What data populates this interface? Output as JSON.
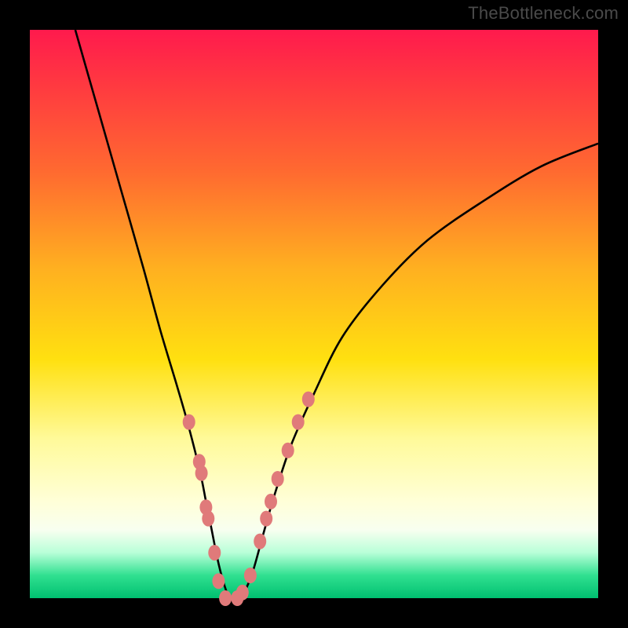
{
  "watermark": {
    "text": "TheBottleneck.com"
  },
  "colors": {
    "curve_stroke": "#000000",
    "dot_fill": "#e07a7a",
    "dot_stroke": "#c85a5a"
  },
  "chart_data": {
    "type": "line",
    "title": "",
    "xlabel": "",
    "ylabel": "",
    "xlim": [
      0,
      100
    ],
    "ylim": [
      0,
      100
    ],
    "left_curve": [
      {
        "x": 8,
        "y": 100
      },
      {
        "x": 12,
        "y": 86
      },
      {
        "x": 16,
        "y": 72
      },
      {
        "x": 20,
        "y": 58
      },
      {
        "x": 23,
        "y": 47
      },
      {
        "x": 26,
        "y": 37
      },
      {
        "x": 28,
        "y": 30
      },
      {
        "x": 30,
        "y": 22
      },
      {
        "x": 31,
        "y": 17
      },
      {
        "x": 32,
        "y": 12
      },
      {
        "x": 33,
        "y": 7
      },
      {
        "x": 34,
        "y": 3
      },
      {
        "x": 35,
        "y": 0
      }
    ],
    "right_curve": [
      {
        "x": 35,
        "y": 0
      },
      {
        "x": 37,
        "y": 0
      },
      {
        "x": 39,
        "y": 4
      },
      {
        "x": 41,
        "y": 11
      },
      {
        "x": 43,
        "y": 18
      },
      {
        "x": 46,
        "y": 27
      },
      {
        "x": 50,
        "y": 36
      },
      {
        "x": 55,
        "y": 46
      },
      {
        "x": 62,
        "y": 55
      },
      {
        "x": 70,
        "y": 63
      },
      {
        "x": 80,
        "y": 70
      },
      {
        "x": 90,
        "y": 76
      },
      {
        "x": 100,
        "y": 80
      }
    ],
    "dots": [
      {
        "x": 28.0,
        "y": 31
      },
      {
        "x": 29.8,
        "y": 24
      },
      {
        "x": 30.2,
        "y": 22
      },
      {
        "x": 31.0,
        "y": 16
      },
      {
        "x": 31.4,
        "y": 14
      },
      {
        "x": 32.5,
        "y": 8
      },
      {
        "x": 33.2,
        "y": 3
      },
      {
        "x": 34.4,
        "y": 0
      },
      {
        "x": 36.5,
        "y": 0
      },
      {
        "x": 37.4,
        "y": 1
      },
      {
        "x": 38.8,
        "y": 4
      },
      {
        "x": 40.5,
        "y": 10
      },
      {
        "x": 41.6,
        "y": 14
      },
      {
        "x": 42.4,
        "y": 17
      },
      {
        "x": 43.6,
        "y": 21
      },
      {
        "x": 45.4,
        "y": 26
      },
      {
        "x": 47.2,
        "y": 31
      },
      {
        "x": 49.0,
        "y": 35
      }
    ]
  }
}
